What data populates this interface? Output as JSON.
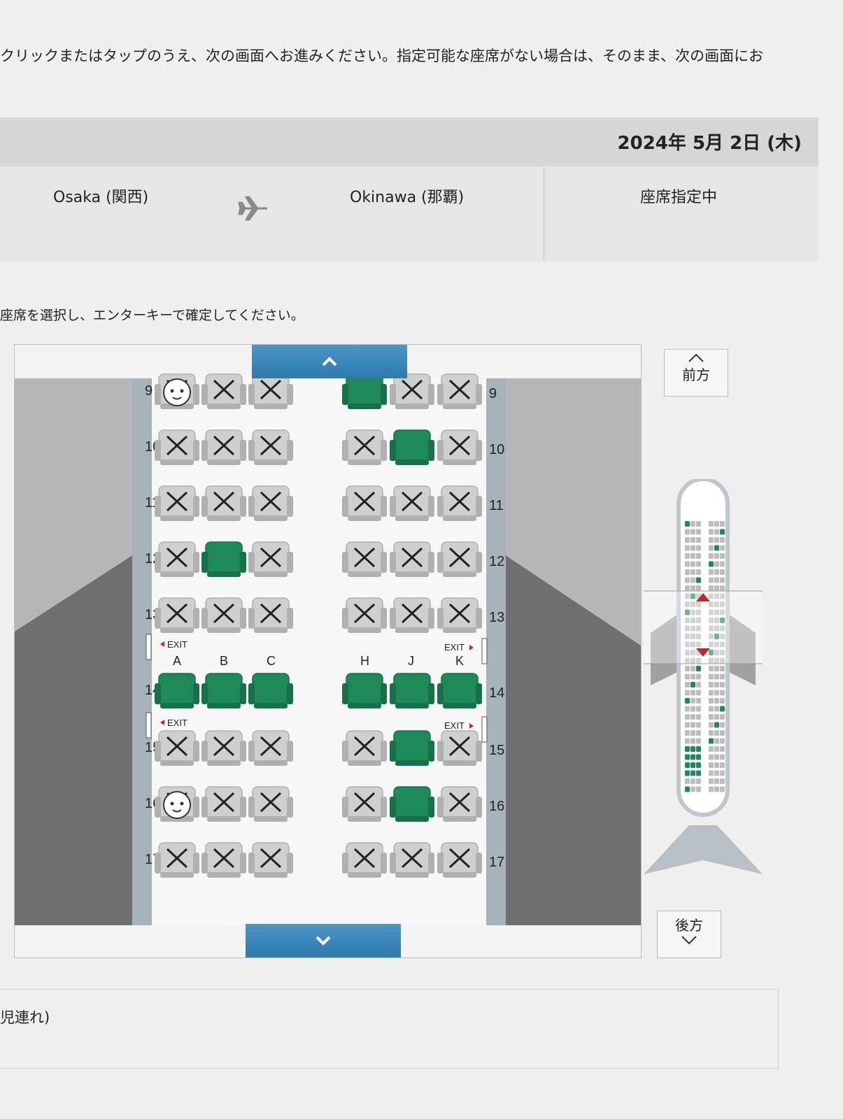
{
  "instruction_text": "クリックまたはタップのうえ、次の画面へお進みください。指定可能な座席がない場合は、そのまま、次の画面にお",
  "flight": {
    "date": "2024年 5月 2日 (木)",
    "origin": "Osaka (関西)",
    "destination": "Okinawa (那覇)",
    "status": "座席指定中"
  },
  "seat_prompt": "座席を選択し、エンターキーで確定してください。",
  "nav": {
    "forward_label": "前方",
    "backward_label": "後方"
  },
  "legend_text": "児連れ)",
  "seat_map": {
    "left_columns": [
      "A",
      "B",
      "C"
    ],
    "right_columns": [
      "H",
      "J",
      "K"
    ],
    "exit_label": "EXIT",
    "rows": [
      {
        "row": "9",
        "seats": [
          "baby",
          "occupied",
          "occupied",
          "available",
          "occupied",
          "occupied"
        ]
      },
      {
        "row": "10",
        "seats": [
          "occupied",
          "occupied",
          "occupied",
          "occupied",
          "available",
          "occupied"
        ]
      },
      {
        "row": "11",
        "seats": [
          "occupied",
          "occupied",
          "occupied",
          "occupied",
          "occupied",
          "occupied"
        ]
      },
      {
        "row": "12",
        "seats": [
          "occupied",
          "available",
          "occupied",
          "occupied",
          "occupied",
          "occupied"
        ]
      },
      {
        "row": "13",
        "seats": [
          "occupied",
          "occupied",
          "occupied",
          "occupied",
          "occupied",
          "occupied"
        ]
      },
      {
        "row": "14",
        "seats": [
          "available",
          "available",
          "available",
          "available",
          "available",
          "available"
        ],
        "exit_row": true
      },
      {
        "row": "15",
        "seats": [
          "occupied",
          "occupied",
          "occupied",
          "occupied",
          "available",
          "occupied"
        ]
      },
      {
        "row": "16",
        "seats": [
          "baby",
          "occupied",
          "occupied",
          "occupied",
          "available",
          "occupied"
        ]
      },
      {
        "row": "17",
        "seats": [
          "occupied",
          "occupied",
          "occupied",
          "occupied",
          "occupied",
          "occupied"
        ]
      }
    ]
  },
  "colors": {
    "available": "#1e8a5a",
    "occupied": "#cfcfcf",
    "scroll_button": "#3a87bb",
    "indicator": "#c0292b"
  }
}
